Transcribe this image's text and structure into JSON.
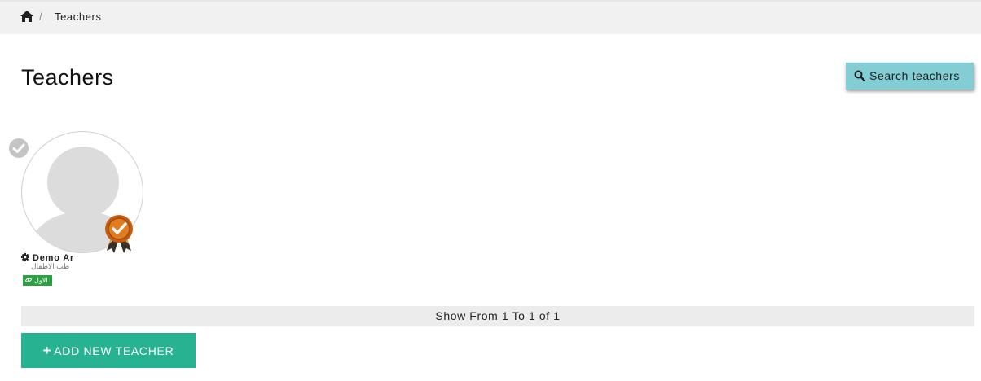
{
  "breadcrumb": {
    "home_icon": "home-icon",
    "separator": "/",
    "current": "Teachers"
  },
  "page": {
    "title": "Teachers"
  },
  "search_button": {
    "icon": "search-icon",
    "label": "Search teachers",
    "bg_color": "#83ced4"
  },
  "teachers": [
    {
      "verified_icon": "check-circle-icon",
      "avatar_icon": "user-placeholder-icon",
      "medal_icon": "award-medal-icon",
      "settings_icon": "gear-icon",
      "name": "Demo Ar",
      "subtitle": "طب الاطفال",
      "tag_icon": "link-icon",
      "tag": "الاول",
      "tag_color": "#2ea043"
    }
  ],
  "pagination": {
    "text": "Show From 1 To 1 of 1"
  },
  "add_button": {
    "icon": "plus-icon",
    "label": "ADD NEW TEACHER",
    "bg_color": "#27b391"
  }
}
